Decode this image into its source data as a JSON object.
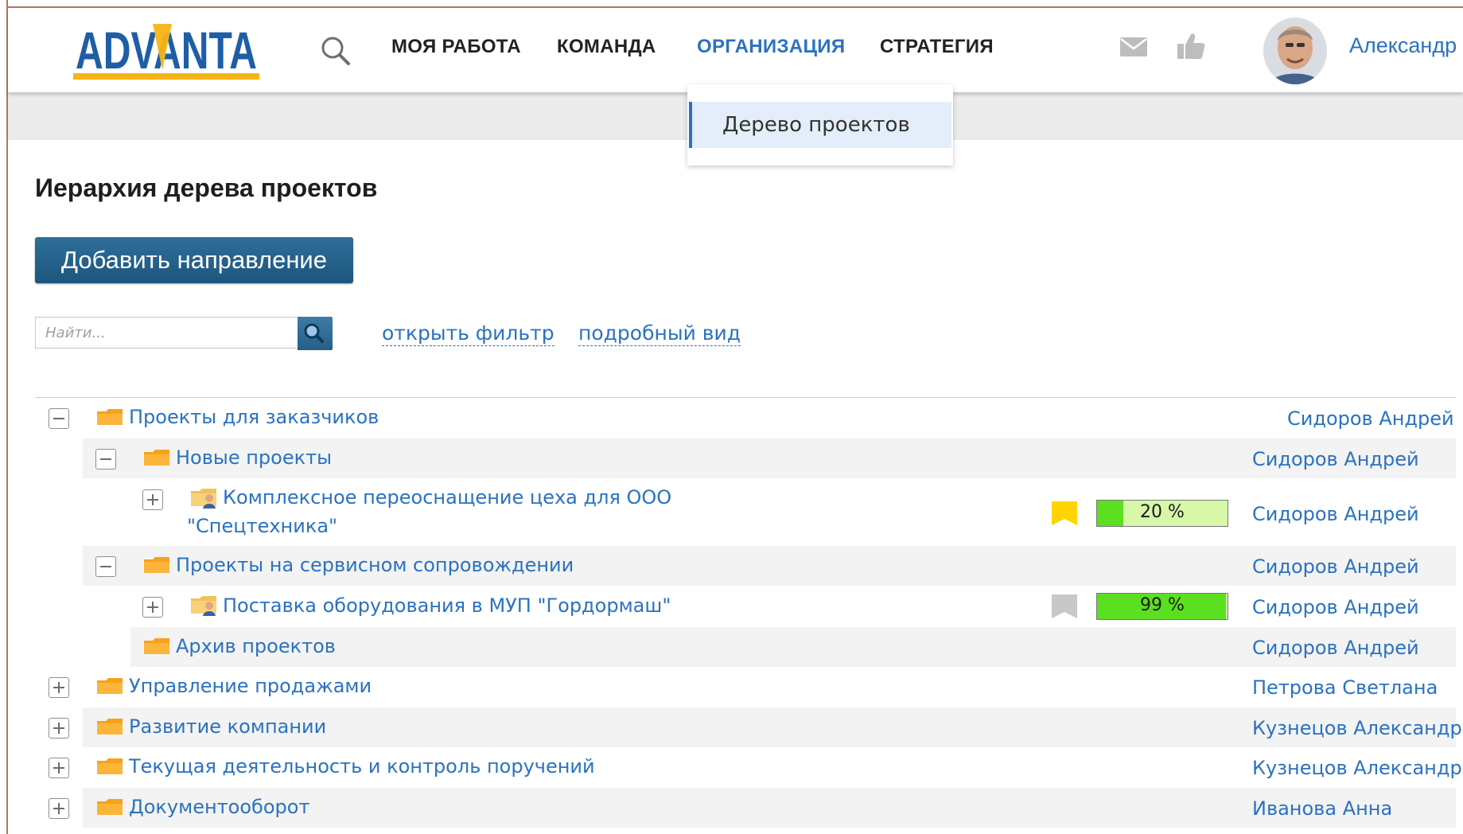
{
  "header": {
    "logo_text": "ADVANTA",
    "nav": [
      {
        "label": "МОЯ РАБОТА",
        "active": false
      },
      {
        "label": "КОМАНДА",
        "active": false
      },
      {
        "label": "ОРГАНИЗАЦИЯ",
        "active": true
      },
      {
        "label": "СТРАТЕГИЯ",
        "active": false
      }
    ],
    "user_name": "Александр",
    "icons": [
      "search-icon",
      "mail-icon",
      "like-icon"
    ]
  },
  "dropdown": {
    "items": [
      "Дерево проектов"
    ]
  },
  "page": {
    "title": "Иерархия дерева проектов",
    "add_button": "Добавить направление",
    "search_placeholder": "Найти...",
    "open_filter": "открыть фильтр",
    "detailed_view": "подробный вид"
  },
  "colors": {
    "accent": "#2a72c2",
    "button": "#1d557d",
    "folder": "#f7a21b",
    "progress_fill": "#5be021",
    "progress_bg": "#d7f7a9",
    "flag_yellow": "#ffd400",
    "flag_gray": "#c8c8c8"
  },
  "tree": [
    {
      "label": "Проекты для заказчиков",
      "owner": "Сидоров Андрей",
      "toggle": "minus",
      "icon": "folder-icon"
    },
    {
      "label": "Новые проекты",
      "owner": "Сидоров Андрей",
      "toggle": "minus",
      "icon": "folder-icon"
    },
    {
      "label_line1": "Комплексное переоснащение цеха для ООО",
      "label_line2": "\"Спецтехника\"",
      "owner": "Сидоров Андрей",
      "toggle": "plus",
      "icon": "project-folder-icon",
      "flag": "yellow",
      "progress_label": "20 %",
      "progress": 0.2
    },
    {
      "label": "Проекты на сервисном сопровождении",
      "owner": "Сидоров Андрей",
      "toggle": "minus",
      "icon": "folder-icon"
    },
    {
      "label": "Поставка оборудования в МУП \"Гордормаш\"",
      "owner": "Сидоров Андрей",
      "toggle": "plus",
      "icon": "project-folder-icon",
      "flag": "gray",
      "progress_label": "99 %",
      "progress": 0.99
    },
    {
      "label": "Архив проектов",
      "owner": "Сидоров Андрей",
      "icon": "folder-icon"
    },
    {
      "label": "Управление продажами",
      "owner": "Петрова Светлана",
      "toggle": "plus",
      "icon": "folder-icon"
    },
    {
      "label": "Развитие компании",
      "owner": "Кузнецов Александр",
      "toggle": "plus",
      "icon": "folder-icon"
    },
    {
      "label": "Текущая деятельность и контроль поручений",
      "owner": "Кузнецов Александр",
      "toggle": "plus",
      "icon": "folder-icon"
    },
    {
      "label": "Документооборот",
      "owner": "Иванова Анна",
      "toggle": "plus",
      "icon": "folder-icon"
    }
  ]
}
